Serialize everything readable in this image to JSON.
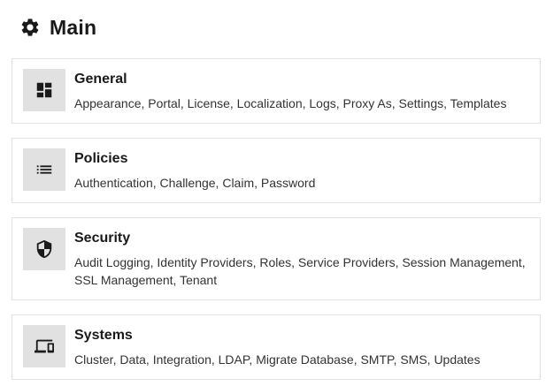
{
  "header": {
    "icon": "gear-icon",
    "title": "Main"
  },
  "cards": [
    {
      "icon": "dashboard-icon",
      "title": "General",
      "description": "Appearance, Portal, License, Localization, Logs, Proxy As, Settings, Templates"
    },
    {
      "icon": "list-icon",
      "title": "Policies",
      "description": "Authentication, Challenge, Claim, Password"
    },
    {
      "icon": "shield-icon",
      "title": "Security",
      "description": "Audit Logging, Identity Providers, Roles, Service Providers, Session Management, SSL Management, Tenant"
    },
    {
      "icon": "devices-icon",
      "title": "Systems",
      "description": "Cluster, Data, Integration, LDAP, Migrate Database, SMTP, SMS, Updates"
    }
  ],
  "colors": {
    "icon_box_bg": "#e1e1e1",
    "card_border": "#e3e3e3",
    "text": "#212121"
  }
}
